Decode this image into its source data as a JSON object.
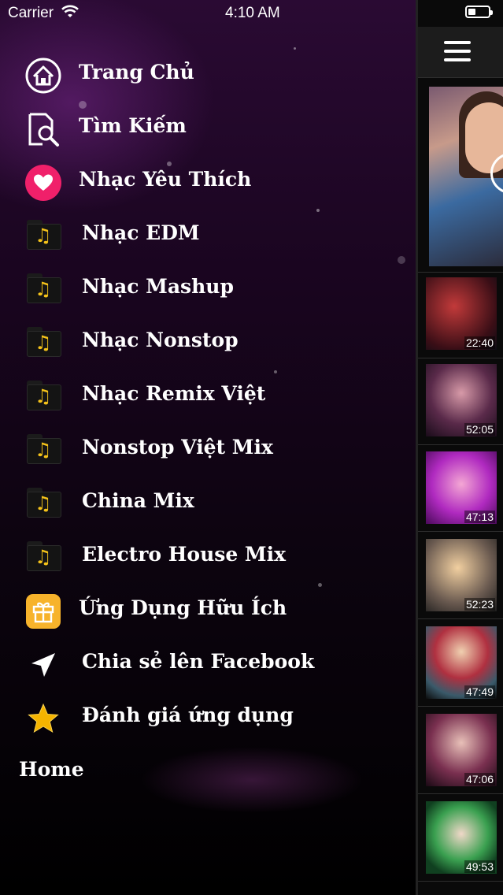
{
  "status_bar": {
    "carrier": "Carrier",
    "time": "4:10 AM"
  },
  "menu": {
    "items": [
      {
        "label": "Trang Chủ",
        "icon": "home-icon"
      },
      {
        "label": "Tìm Kiếm",
        "icon": "search-icon"
      },
      {
        "label": "Nhạc Yêu Thích",
        "icon": "heart-icon"
      },
      {
        "label": "Nhạc EDM",
        "icon": "music-folder-icon"
      },
      {
        "label": "Nhạc Mashup",
        "icon": "music-folder-icon"
      },
      {
        "label": "Nhạc Nonstop",
        "icon": "music-folder-icon"
      },
      {
        "label": "Nhạc Remix Việt",
        "icon": "music-folder-icon"
      },
      {
        "label": "Nonstop Việt Mix",
        "icon": "music-folder-icon"
      },
      {
        "label": "China Mix",
        "icon": "music-folder-icon"
      },
      {
        "label": "Electro House Mix",
        "icon": "music-folder-icon"
      },
      {
        "label": "Ứng Dụng Hữu Ích",
        "icon": "gift-icon"
      },
      {
        "label": "Chia sẻ lên Facebook",
        "icon": "share-arrow-icon"
      },
      {
        "label": "Đánh giá ứng dụng",
        "icon": "star-icon"
      }
    ],
    "footer_label": "Home"
  },
  "video_list": {
    "durations": [
      "22:40",
      "52:05",
      "47:13",
      "52:23",
      "47:49",
      "47:06",
      "49:53"
    ]
  },
  "colors": {
    "heart": "#f0206a",
    "note": "#f4c21a",
    "star": "#f5b400",
    "gift": "#f7b32b"
  }
}
